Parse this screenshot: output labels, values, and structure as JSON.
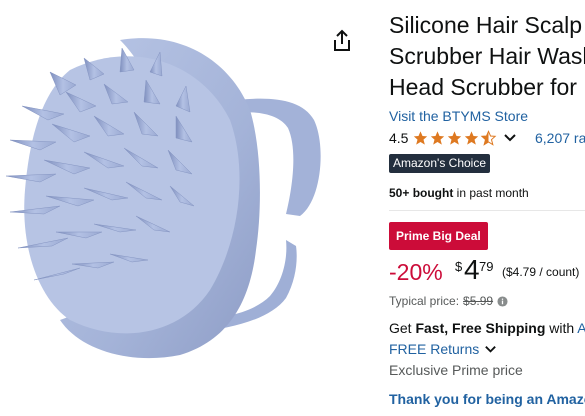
{
  "product": {
    "title": "Silicone Hair Scalp Scrubber Hair Washing Head Scrubber for",
    "store_link": "Visit the BTYMS Store",
    "rating_value": "4.5",
    "rating_stars": 4.5,
    "review_count": "6,207 ra",
    "choice_badge": "Amazon's Choice",
    "bought_bold": "50+ bought",
    "bought_rest": " in past month",
    "deal_badge": "Prime Big Deal",
    "discount": "-20%",
    "currency": "$",
    "price_whole": "4",
    "price_fraction": "79",
    "unit_price": "($4.79 / count)",
    "typical_label": "Typical price:",
    "typical_price": "$5.99",
    "shipping_prefix": "Get ",
    "shipping_bold": "Fast, Free Shipping",
    "shipping_with": " with ",
    "shipping_link": "A",
    "returns": "FREE Returns",
    "exclusive": "Exclusive Prime price",
    "thanks": "Thank you for being an Amazo"
  },
  "colors": {
    "link": "#2162a1",
    "deal_red": "#cc0c39",
    "star": "#de7921",
    "badge_bg": "#232f3e",
    "product_blue": "#a9b8dc"
  },
  "icons": {
    "share": "share-icon",
    "chevron": "chevron-down-icon",
    "info": "info-icon",
    "star": "star-icon"
  }
}
